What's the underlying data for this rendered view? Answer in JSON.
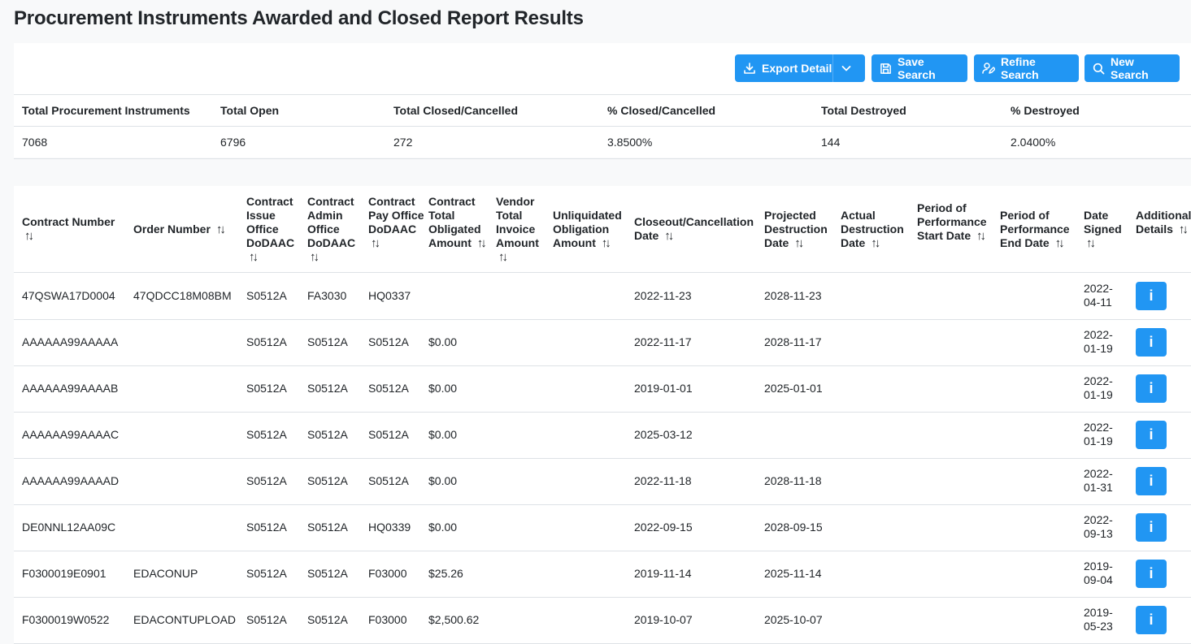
{
  "page": {
    "title": "Procurement Instruments Awarded and Closed Report Results"
  },
  "toolbar": {
    "export_label": "Export Detail",
    "save_label": "Save Search",
    "refine_label": "Refine Search",
    "new_label": "New Search"
  },
  "summary": {
    "headers": [
      "Total Procurement Instruments",
      "Total Open",
      "Total Closed/Cancelled",
      "% Closed/Cancelled",
      "Total Destroyed",
      "% Destroyed"
    ],
    "values": [
      "7068",
      "6796",
      "272",
      "3.8500%",
      "144",
      "2.0400%"
    ]
  },
  "results": {
    "sort_symbol": "↑↓",
    "columns": [
      "Contract Number",
      "Order Number",
      "Contract Issue Office DoDAAC",
      "Contract Admin Office DoDAAC",
      "Contract Pay Office DoDAAC",
      "Contract Total Obligated Amount",
      "Vendor Total Invoice Amount",
      "Unliquidated Obligation Amount",
      "Closeout/Cancellation Date",
      "Projected Destruction Date",
      "Actual Destruction Date",
      "Period of Performance Start Date",
      "Period of Performance End Date",
      "Date Signed",
      "Additional Details"
    ],
    "info_label": "i",
    "rows": [
      [
        "47QSWA17D0004",
        "47QDCC18M08BM",
        "S0512A",
        "FA3030",
        "HQ0337",
        "",
        "",
        "",
        "2022-11-23",
        "2028-11-23",
        "",
        "",
        "",
        "2022-04-11"
      ],
      [
        "AAAAAA99AAAAA",
        "",
        "S0512A",
        "S0512A",
        "S0512A",
        "$0.00",
        "",
        "",
        "2022-11-17",
        "2028-11-17",
        "",
        "",
        "",
        "2022-01-19"
      ],
      [
        "AAAAAA99AAAAB",
        "",
        "S0512A",
        "S0512A",
        "S0512A",
        "$0.00",
        "",
        "",
        "2019-01-01",
        "2025-01-01",
        "",
        "",
        "",
        "2022-01-19"
      ],
      [
        "AAAAAA99AAAAC",
        "",
        "S0512A",
        "S0512A",
        "S0512A",
        "$0.00",
        "",
        "",
        "2025-03-12",
        "",
        "",
        "",
        "",
        "2022-01-19"
      ],
      [
        "AAAAAA99AAAAD",
        "",
        "S0512A",
        "S0512A",
        "S0512A",
        "$0.00",
        "",
        "",
        "2022-11-18",
        "2028-11-18",
        "",
        "",
        "",
        "2022-01-31"
      ],
      [
        "DE0NNL12AA09C",
        "",
        "S0512A",
        "S0512A",
        "HQ0339",
        "$0.00",
        "",
        "",
        "2022-09-15",
        "2028-09-15",
        "",
        "",
        "",
        "2022-09-13"
      ],
      [
        "F0300019E0901",
        "EDACONUP",
        "S0512A",
        "S0512A",
        "F03000",
        "$25.26",
        "",
        "",
        "2019-11-14",
        "2025-11-14",
        "",
        "",
        "",
        "2019-09-04"
      ],
      [
        "F0300019W0522",
        "EDACONTUPLOAD",
        "S0512A",
        "S0512A",
        "F03000",
        "$2,500.62",
        "",
        "",
        "2019-10-07",
        "2025-10-07",
        "",
        "",
        "",
        "2019-05-23"
      ]
    ]
  },
  "colors": {
    "accent": "#2196f3",
    "background": "#f8f9fa",
    "border": "#dee2e6"
  }
}
